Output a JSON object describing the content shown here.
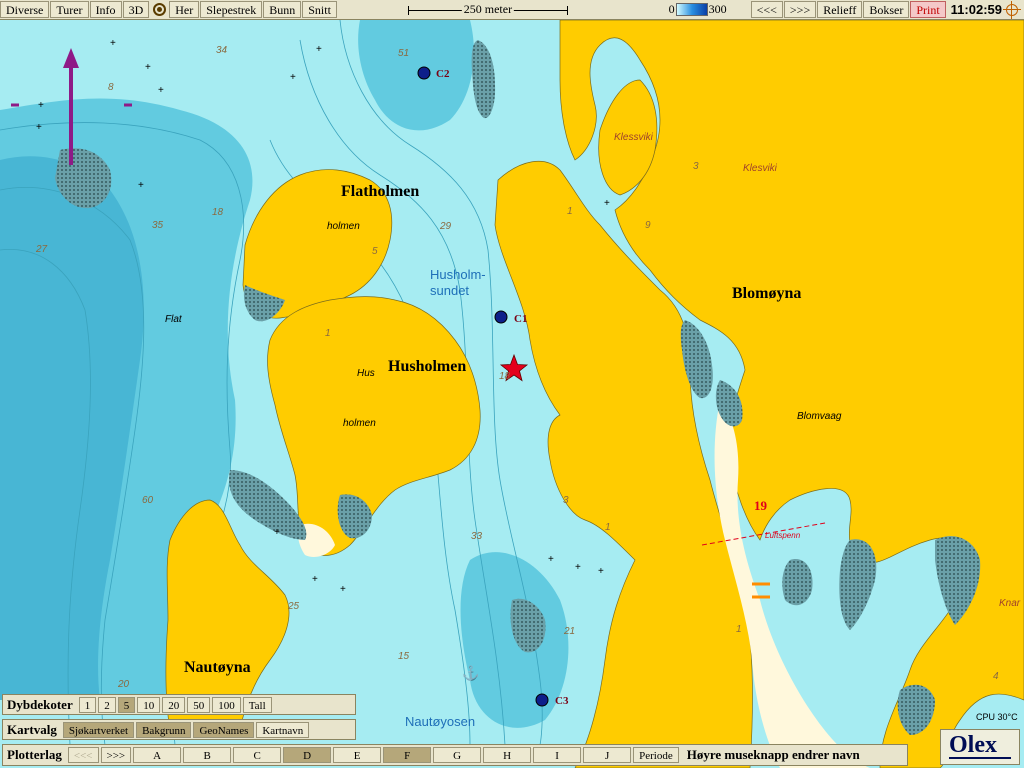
{
  "toolbar": {
    "buttons": [
      "Diverse",
      "Turer",
      "Info",
      "3D",
      "Her",
      "Slepestrek",
      "Bunn",
      "Snitt"
    ],
    "scale_label": "250 meter",
    "depth_min": "0",
    "depth_max": "300",
    "nav_prev": "<<<",
    "nav_next": ">>>",
    "relief": "Relieff",
    "bokser": "Bokser",
    "print": "Print",
    "time": "11:02:59"
  },
  "map": {
    "colors": {
      "land": "#ffcc00",
      "shallow": "#a6ecf2",
      "deep": "#4cc2dc",
      "drying": "#fff8dc",
      "coast": "#7a6c1c"
    },
    "places": {
      "flatholmen": "Flatholmen",
      "husholmen": "Husholmen",
      "blomoyna": "Blomøyna",
      "nautoyna": "Nautøyna"
    },
    "water_names": {
      "husholmsundet_1": "Husholm-",
      "husholmsundet_2": "sundet",
      "nautoyosen": "Nautøyosen"
    },
    "small_names": {
      "klessviki_a": "Klessviki",
      "klessviki_b": "Klesviki",
      "blomvaag": "Blomvaag",
      "holmen_a": "holmen",
      "hus": "Hus",
      "holmen_b": "holmen",
      "flat": "Flat",
      "knar": "Knar",
      "luftspenn": "Luftspenn"
    },
    "markers": {
      "c1": "C1",
      "c2": "C2",
      "c3": "C3"
    },
    "depth_numbers": {
      "d34": "34",
      "d51": "51",
      "d8": "8",
      "d3a": "3",
      "d18": "18",
      "d27": "27",
      "d35": "35",
      "d5": "5",
      "d29": "29",
      "d1a": "1",
      "d9": "9",
      "d1b": "1",
      "d18b": "18",
      "d60": "60",
      "d33": "33",
      "d3b": "3",
      "d1c": "1",
      "d25": "25",
      "d15": "15",
      "d20": "20",
      "d21": "21",
      "d1d": "1",
      "d4": "4",
      "d19": "19"
    }
  },
  "cpu": "CPU 30°C",
  "dybdekoter": {
    "title": "Dybdekoter",
    "options": [
      "1",
      "2",
      "5",
      "10",
      "20",
      "50",
      "100",
      "Tall"
    ],
    "selected": "5"
  },
  "kartvalg": {
    "title": "Kartvalg",
    "options": [
      "Sjøkartverket",
      "Bakgrunn",
      "GeoNames",
      "Kartnavn"
    ]
  },
  "plotterlag": {
    "title": "Plotterlag",
    "prev": "<<<",
    "next": ">>>",
    "layers": [
      "A",
      "B",
      "C",
      "D",
      "E",
      "F",
      "G",
      "H",
      "I",
      "J"
    ],
    "selected": [
      "D",
      "F"
    ],
    "periode": "Periode",
    "hint": "Høyre museknapp endrer navn"
  },
  "logo": "Olex"
}
